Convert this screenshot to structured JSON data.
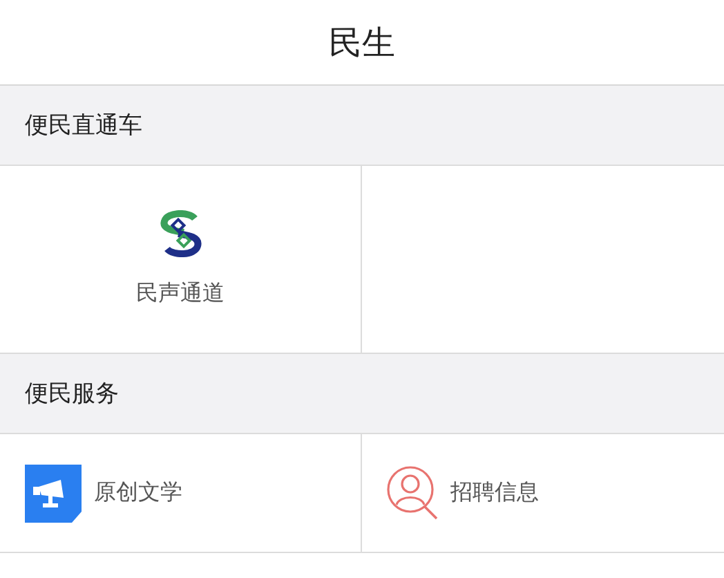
{
  "header": {
    "title": "民生"
  },
  "sections": [
    {
      "title": "便民直通车",
      "kind": "stacked",
      "items": [
        {
          "label": "民声通道"
        }
      ]
    },
    {
      "title": "便民服务",
      "kind": "inline",
      "items": [
        {
          "label": "原创文学"
        },
        {
          "label": "招聘信息"
        }
      ]
    }
  ]
}
